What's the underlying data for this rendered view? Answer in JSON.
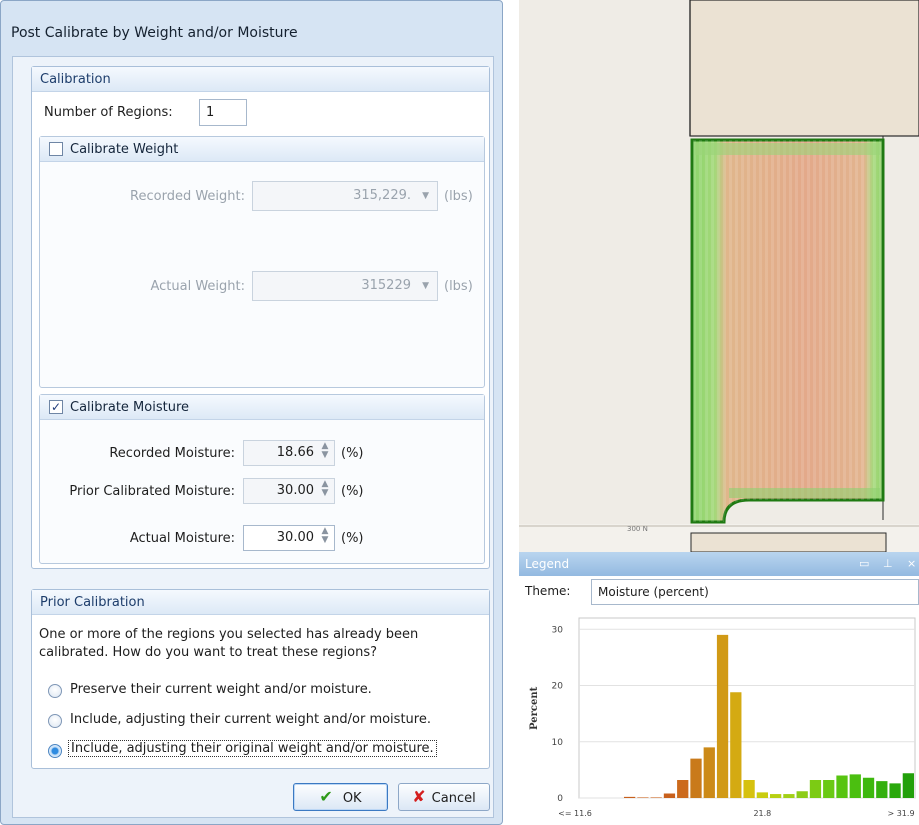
{
  "dialog": {
    "title": "Post Calibrate by Weight and/or Moisture",
    "calibration": {
      "header": "Calibration",
      "regions_label": "Number of Regions:",
      "regions_value": "1",
      "weight": {
        "checkbox_label": "Calibrate Weight",
        "checked": false,
        "recorded_label": "Recorded Weight:",
        "recorded_value": "315,229.",
        "actual_label": "Actual Weight:",
        "actual_value": "315229",
        "unit": "(lbs)"
      },
      "moisture": {
        "checkbox_label": "Calibrate Moisture",
        "checked": true,
        "check_glyph": "✓",
        "recorded_label": "Recorded Moisture:",
        "recorded_value": "18.66",
        "prior_label": "Prior Calibrated Moisture:",
        "prior_value": "30.00",
        "actual_label": "Actual Moisture:",
        "actual_value": "30.00",
        "unit": "(%)"
      }
    },
    "prior": {
      "header": "Prior Calibration",
      "description_line1": "One or more of the regions you selected has already been",
      "description_line2": "calibrated.  How do you want to treat these regions?",
      "options": [
        {
          "label": "Preserve their current weight and/or moisture.",
          "selected": false
        },
        {
          "label": "Include, adjusting their current weight and/or moisture.",
          "selected": false
        },
        {
          "label": "Include, adjusting their original weight and/or moisture.",
          "selected": true
        }
      ]
    },
    "buttons": {
      "ok": "OK",
      "cancel": "Cancel"
    }
  },
  "map": {
    "road_label": "300 N"
  },
  "legend": {
    "title": "Legend",
    "theme_label": "Theme:",
    "theme_value": "Moisture (percent)",
    "colors": {
      "field_outline": "#1f7a12",
      "dry": "#2ea10f",
      "wet": "#c7651c"
    }
  },
  "chart_data": {
    "type": "bar",
    "ylabel": "Percent",
    "ylim": [
      0,
      32
    ],
    "yticks": [
      0,
      10,
      20,
      30
    ],
    "xtick_labels": [
      "<= 11.6",
      "21.8",
      "> 31.9"
    ],
    "values": [
      0.2,
      0.1,
      0.1,
      0.8,
      3.2,
      7.0,
      9.0,
      29.0,
      18.8,
      3.2,
      1.0,
      0.7,
      0.7,
      1.2,
      3.2,
      3.2,
      4.0,
      4.2,
      3.6,
      3.0,
      2.6,
      4.4
    ],
    "colors": [
      "#c8601c",
      "#c8601c",
      "#c8601c",
      "#c8601c",
      "#cc6a1c",
      "#c97a1a",
      "#cc8a18",
      "#d19a16",
      "#d4aa12",
      "#d6c10e",
      "#c9cc10",
      "#b7d012",
      "#a2d016",
      "#8ccc16",
      "#7ccb14",
      "#6ac914",
      "#57c410",
      "#4bbf10",
      "#3db80e",
      "#34b00e",
      "#2aa80c",
      "#22a00a"
    ]
  }
}
